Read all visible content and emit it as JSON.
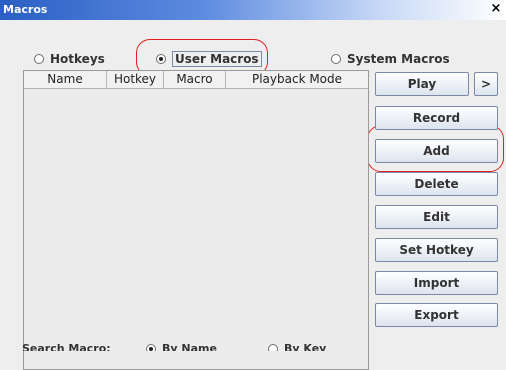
{
  "window": {
    "title": "Macros",
    "close_glyph": "×"
  },
  "type_options": [
    {
      "label": "Hotkeys",
      "selected": false
    },
    {
      "label": "User Macros",
      "selected": true
    },
    {
      "label": "System Macros",
      "selected": false
    }
  ],
  "table": {
    "columns": [
      "Name",
      "Hotkey",
      "Macro",
      "Playback Mode"
    ],
    "rows": []
  },
  "buttons": {
    "play": "Play",
    "more": ">",
    "record": "Record",
    "add": "Add",
    "delete": "Delete",
    "edit": "Edit",
    "set_hotkey": "Set Hotkey",
    "import": "Import",
    "export": "Export"
  },
  "search": {
    "label": "Search Macro:",
    "options": [
      {
        "label": "By Name",
        "selected": true
      },
      {
        "label": "By Key",
        "selected": false
      }
    ]
  },
  "colors": {
    "title_bar": "#2a5fc4",
    "annotation": "#e02020"
  }
}
